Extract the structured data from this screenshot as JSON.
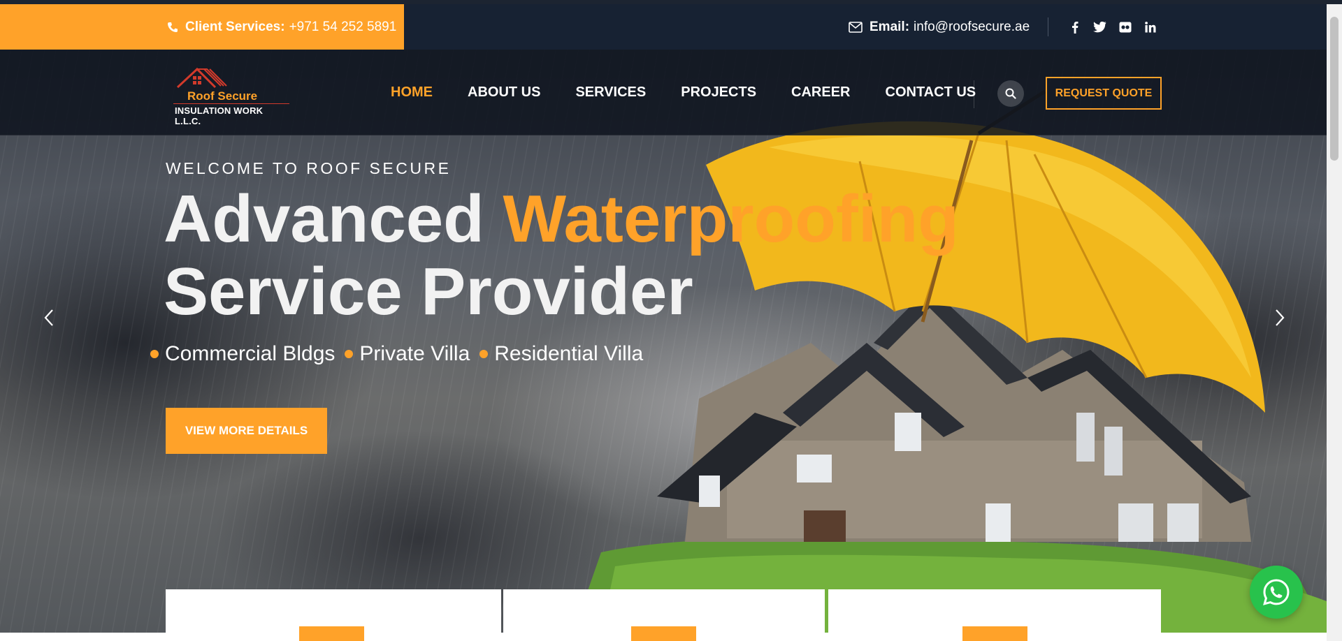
{
  "topbar": {
    "client_label": "Client Services:",
    "client_phone": "+971 54 252 5891",
    "email_label": "Email:",
    "email_value": "info@roofsecure.ae",
    "socials": [
      "facebook-icon",
      "twitter-icon",
      "flickr-icon",
      "linkedin-icon"
    ]
  },
  "logo": {
    "brand": "Roof Secure",
    "subtitle": "INSULATION WORK L.L.C."
  },
  "nav": {
    "items": [
      {
        "label": "HOME",
        "active": true
      },
      {
        "label": "ABOUT US",
        "active": false
      },
      {
        "label": "SERVICES",
        "active": false
      },
      {
        "label": "PROJECTS",
        "active": false
      },
      {
        "label": "CAREER",
        "active": false
      },
      {
        "label": "CONTACT US",
        "active": false
      }
    ],
    "quote_label": "REQUEST QUOTE"
  },
  "hero": {
    "welcome": "WELCOME TO ROOF SECURE",
    "headline_part1": "Advanced",
    "headline_accent": "Waterproofing",
    "headline_line2": "Service Provider",
    "services": [
      "Commercial Bldgs",
      "Private Villa",
      "Residential Villa"
    ],
    "cta_label": "VIEW MORE DETAILS"
  },
  "colors": {
    "accent": "#ffa229",
    "topbar_bg": "#172233",
    "whatsapp": "#28c24c"
  }
}
